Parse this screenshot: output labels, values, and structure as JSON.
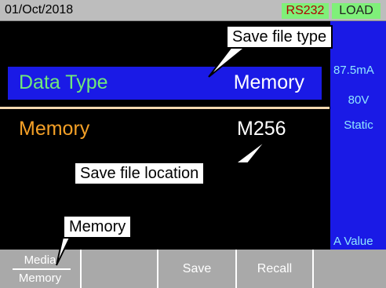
{
  "status_bar": {
    "date": "01/Oct/2018",
    "interface": "RS232",
    "mode": "LOAD",
    "badge_color": "#7ff079"
  },
  "main": {
    "data_type": {
      "label": "Data Type",
      "value": "Memory"
    },
    "memory": {
      "label": "Memory",
      "value": "M256"
    }
  },
  "side_panel": {
    "current": "87.5mA",
    "voltage": "80V",
    "mode": "Static",
    "value_label": "A Value"
  },
  "softkeys": {
    "media_top": "Media",
    "media_bottom": "Memory",
    "save": "Save",
    "recall": "Recall"
  },
  "annotations": {
    "file_type": "Save file type",
    "file_location": "Save file location",
    "memory": "Memory"
  },
  "colors": {
    "highlight_blue": "#1a1ae6",
    "label_green": "#6fe87a",
    "label_orange": "#f4a027",
    "softkey_gray": "#a9a9a9"
  }
}
